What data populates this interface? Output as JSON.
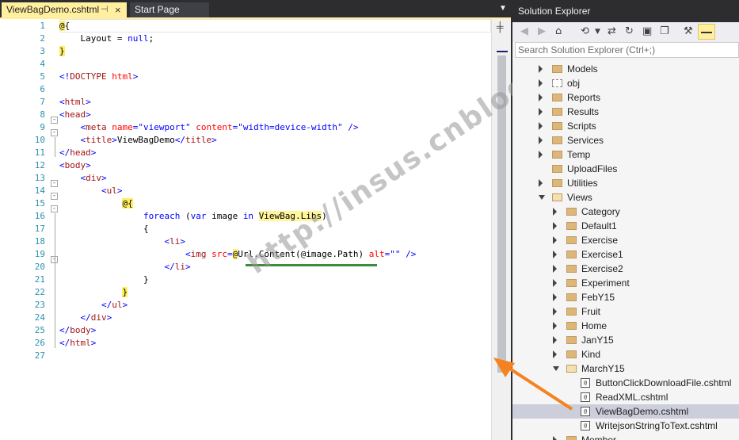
{
  "editor": {
    "tabs": [
      {
        "label": "ViewBagDemo.cshtml",
        "active": true
      },
      {
        "label": "Start Page",
        "active": false
      }
    ],
    "pin_icon": "pin-icon",
    "close_icon": "close-icon",
    "line_numbers": [
      "1",
      "2",
      "3",
      "4",
      "5",
      "6",
      "7",
      "8",
      "9",
      "10",
      "11",
      "12",
      "13",
      "14",
      "15",
      "16",
      "17",
      "18",
      "19",
      "20",
      "21",
      "22",
      "23",
      "24",
      "25",
      "26",
      "27"
    ],
    "watermark": "http://insus.cnblogs.com",
    "colors": {
      "keyword": "#0000ff",
      "tag": "#a31515",
      "attr": "#ff0000",
      "razor_highlight": "#ffee62",
      "line_number": "#2b91af",
      "underline": "#3c8c3c"
    }
  },
  "code": {
    "l1": {
      "at": "@",
      "brace": "{"
    },
    "l2": {
      "indent": "    ",
      "ident": "Layout",
      "eq": " = ",
      "kw": "null",
      "semi": ";"
    },
    "l3": {
      "brace": "}"
    },
    "l5": {
      "open": "<!",
      "tag": "DOCTYPE",
      "sp": " ",
      "attr": "html",
      "close": ">"
    },
    "l7": {
      "open": "<",
      "tag": "html",
      "close": ">"
    },
    "l8": {
      "open": "<",
      "tag": "head",
      "close": ">"
    },
    "l9": {
      "indent": "    ",
      "open": "<",
      "tag": "meta",
      "sp1": " ",
      "a1": "name",
      "eq1": "=",
      "v1": "\"viewport\"",
      "sp2": " ",
      "a2": "content",
      "eq2": "=",
      "v2": "\"width=device-width\"",
      "close": " />"
    },
    "l10": {
      "indent": "    ",
      "open": "<",
      "tag": "title",
      "gt": ">",
      "text": "ViewBagDemo",
      "lt": "</",
      "etag": "title",
      "close": ">"
    },
    "l11": {
      "open": "</",
      "tag": "head",
      "close": ">"
    },
    "l12": {
      "open": "<",
      "tag": "body",
      "close": ">"
    },
    "l13": {
      "indent": "    ",
      "open": "<",
      "tag": "div",
      "close": ">"
    },
    "l14": {
      "indent": "        ",
      "open": "<",
      "tag": "ul",
      "close": ">"
    },
    "l15": {
      "indent": "            ",
      "at": "@",
      "brace": "{"
    },
    "l16": {
      "indent": "                ",
      "kw1": "foreach",
      "sp1": " (",
      "kw2": "var",
      "mid": " image ",
      "kw3": "in",
      "sp2": " ",
      "hl": "ViewBag.Libs",
      "close": ")"
    },
    "l17": {
      "indent": "                ",
      "brace": "{"
    },
    "l18": {
      "indent": "                    ",
      "open": "<",
      "tag": "li",
      "close": ">"
    },
    "l19": {
      "indent": "                        ",
      "open": "<",
      "tag": "img",
      "sp1": " ",
      "a1": "src",
      "eq1": "=",
      "at": "@",
      "expr": "Url.Content(@image.Path)",
      "sp2": " ",
      "a2": "alt",
      "eq2": "=",
      "v2": "\"\"",
      "close": " />"
    },
    "l20": {
      "indent": "                    ",
      "open": "</",
      "tag": "li",
      "close": ">"
    },
    "l21": {
      "indent": "                ",
      "brace": "}"
    },
    "l22": {
      "indent": "            ",
      "brace": "}"
    },
    "l23": {
      "indent": "        ",
      "open": "</",
      "tag": "ul",
      "close": ">"
    },
    "l24": {
      "indent": "    ",
      "open": "</",
      "tag": "div",
      "close": ">"
    },
    "l25": {
      "open": "</",
      "tag": "body",
      "close": ">"
    },
    "l26": {
      "open": "</",
      "tag": "html",
      "close": ">"
    }
  },
  "solution_explorer": {
    "title": "Solution Explorer",
    "search_placeholder": "Search Solution Explorer (Ctrl+;)",
    "toolbar_icons": [
      "back-icon",
      "forward-icon",
      "home-icon",
      "history-icon",
      "dropdown-icon",
      "sync-icon",
      "refresh-icon",
      "collapse-all-icon",
      "show-all-files-icon",
      "properties-icon",
      "pin-icon"
    ],
    "items": [
      {
        "label": "Models",
        "kind": "folder",
        "level": 0,
        "expander": "collapsed"
      },
      {
        "label": "obj",
        "kind": "folder-hidden",
        "level": 0,
        "expander": "collapsed"
      },
      {
        "label": "Reports",
        "kind": "folder",
        "level": 0,
        "expander": "collapsed"
      },
      {
        "label": "Results",
        "kind": "folder",
        "level": 0,
        "expander": "collapsed"
      },
      {
        "label": "Scripts",
        "kind": "folder",
        "level": 0,
        "expander": "collapsed"
      },
      {
        "label": "Services",
        "kind": "folder",
        "level": 0,
        "expander": "collapsed"
      },
      {
        "label": "Temp",
        "kind": "folder",
        "level": 0,
        "expander": "collapsed"
      },
      {
        "label": "UploadFiles",
        "kind": "folder",
        "level": 0,
        "expander": "none"
      },
      {
        "label": "Utilities",
        "kind": "folder",
        "level": 0,
        "expander": "collapsed"
      },
      {
        "label": "Views",
        "kind": "folder-open",
        "level": 0,
        "expander": "expanded"
      },
      {
        "label": "Category",
        "kind": "folder",
        "level": 1,
        "expander": "collapsed"
      },
      {
        "label": "Default1",
        "kind": "folder",
        "level": 1,
        "expander": "collapsed"
      },
      {
        "label": "Exercise",
        "kind": "folder",
        "level": 1,
        "expander": "collapsed"
      },
      {
        "label": "Exercise1",
        "kind": "folder",
        "level": 1,
        "expander": "collapsed"
      },
      {
        "label": "Exercise2",
        "kind": "folder",
        "level": 1,
        "expander": "collapsed"
      },
      {
        "label": "Experiment",
        "kind": "folder",
        "level": 1,
        "expander": "collapsed"
      },
      {
        "label": "FebY15",
        "kind": "folder",
        "level": 1,
        "expander": "collapsed"
      },
      {
        "label": "Fruit",
        "kind": "folder",
        "level": 1,
        "expander": "collapsed"
      },
      {
        "label": "Home",
        "kind": "folder",
        "level": 1,
        "expander": "collapsed"
      },
      {
        "label": "JanY15",
        "kind": "folder",
        "level": 1,
        "expander": "collapsed"
      },
      {
        "label": "Kind",
        "kind": "folder",
        "level": 1,
        "expander": "collapsed"
      },
      {
        "label": "MarchY15",
        "kind": "folder-open",
        "level": 1,
        "expander": "expanded"
      },
      {
        "label": "ButtonClickDownloadFile.cshtml",
        "kind": "cshtml",
        "level": 2,
        "expander": "none"
      },
      {
        "label": "ReadXML.cshtml",
        "kind": "cshtml",
        "level": 2,
        "expander": "none"
      },
      {
        "label": "ViewBagDemo.cshtml",
        "kind": "cshtml",
        "level": 2,
        "expander": "none",
        "selected": true
      },
      {
        "label": "WritejsonStringToText.cshtml",
        "kind": "cshtml",
        "level": 2,
        "expander": "none"
      },
      {
        "label": "Member",
        "kind": "folder",
        "level": 1,
        "expander": "collapsed"
      }
    ],
    "file_glyph": "[@]",
    "colors": {
      "folder": "#dcb67a",
      "selected_row": "#cccedb",
      "pinned": "#ffef9f"
    }
  },
  "annotation": {
    "arrow_color": "#f58220"
  }
}
